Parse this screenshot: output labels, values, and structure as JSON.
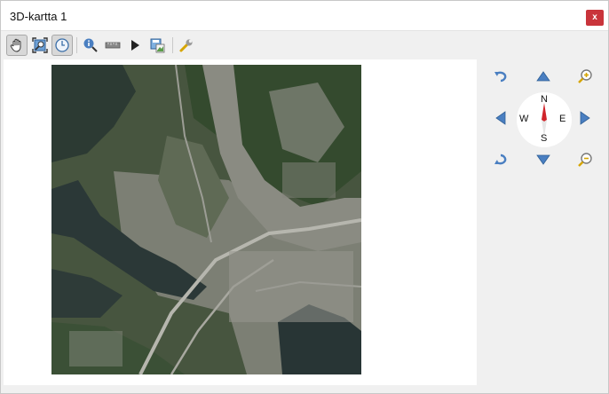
{
  "window": {
    "title": "3D-kartta 1",
    "close_label": "x"
  },
  "toolbar": {
    "buttons": [
      {
        "name": "pan-tool",
        "icon": "hand-icon",
        "active": true
      },
      {
        "name": "zoom-full-extent",
        "icon": "zoom-full-icon",
        "active": false
      },
      {
        "name": "toggle-on-screen-navigation",
        "icon": "compass-toggle-icon",
        "active": true
      },
      {
        "name": "identify-tool",
        "icon": "identify-icon",
        "active": false
      },
      {
        "name": "measurement-tool",
        "icon": "ruler-icon",
        "active": false
      },
      {
        "name": "animations",
        "icon": "play-icon",
        "active": false
      },
      {
        "name": "save-as-image",
        "icon": "save-image-icon",
        "active": false
      },
      {
        "name": "configure",
        "icon": "wrench-icon",
        "active": false
      }
    ]
  },
  "navigation": {
    "compass": {
      "north": "N",
      "south": "S",
      "east": "E",
      "west": "W"
    },
    "controls": [
      "rotate-left-icon",
      "move-up-icon",
      "zoom-in-icon",
      "move-left-icon",
      "move-right-icon",
      "rotate-right-icon",
      "move-down-icon",
      "zoom-out-icon"
    ]
  },
  "colors": {
    "close": "#c9343b",
    "nav_arrow": "#4a7fc1",
    "compass_needle": "#d0242b"
  }
}
